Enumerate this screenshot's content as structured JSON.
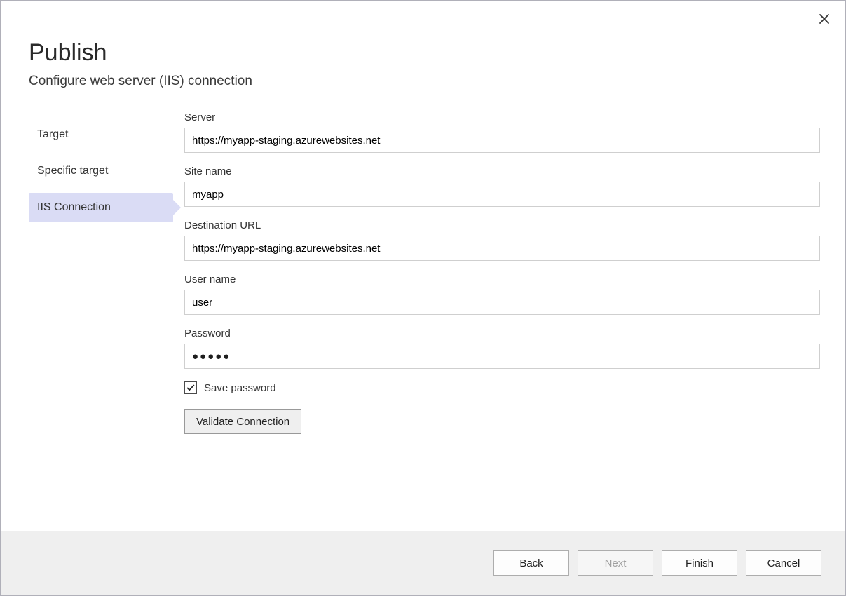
{
  "header": {
    "title": "Publish",
    "subtitle": "Configure web server (IIS) connection"
  },
  "sidebar": {
    "items": [
      {
        "label": "Target",
        "selected": false
      },
      {
        "label": "Specific target",
        "selected": false
      },
      {
        "label": "IIS Connection",
        "selected": true
      }
    ]
  },
  "form": {
    "server_label": "Server",
    "server_value": "https://myapp-staging.azurewebsites.net",
    "sitename_label": "Site name",
    "sitename_value": "myapp",
    "desturl_label": "Destination URL",
    "desturl_value": "https://myapp-staging.azurewebsites.net",
    "username_label": "User name",
    "username_value": "user",
    "password_label": "Password",
    "password_value": "●●●●●",
    "savepassword_label": "Save password",
    "savepassword_checked": true,
    "validate_label": "Validate Connection"
  },
  "footer": {
    "back": "Back",
    "next": "Next",
    "finish": "Finish",
    "cancel": "Cancel"
  }
}
